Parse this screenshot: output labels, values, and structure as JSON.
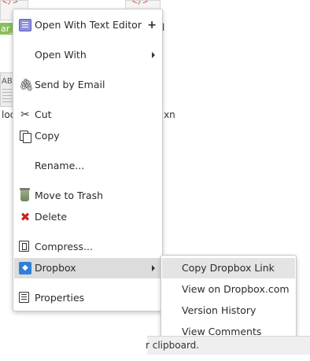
{
  "background": {
    "file_tag": "ar_",
    "doc_label": "AB",
    "file_label_left": "loc",
    "file_label_right": "s.xn",
    "top_right_fragment": "l"
  },
  "context_menu": {
    "items": [
      {
        "label": "Open With Text Editor",
        "icon": "text-editor-icon",
        "suffix": "+"
      },
      {
        "label": "Open With",
        "icon": "",
        "submenu": true
      },
      {
        "label": "Send by Email",
        "icon": "paperclip-icon"
      },
      {
        "label": "Cut",
        "icon": "scissors-icon"
      },
      {
        "label": "Copy",
        "icon": "copy-icon"
      },
      {
        "label": "Rename...",
        "icon": ""
      },
      {
        "label": "Move to Trash",
        "icon": "trash-icon"
      },
      {
        "label": "Delete",
        "icon": "delete-icon"
      },
      {
        "label": "Compress...",
        "icon": "compress-icon"
      },
      {
        "label": "Dropbox",
        "icon": "dropbox-icon",
        "submenu": true,
        "active": true
      },
      {
        "label": "Properties",
        "icon": "properties-icon"
      }
    ]
  },
  "dropbox_submenu": {
    "items": [
      {
        "label": "Copy Dropbox Link",
        "active": true
      },
      {
        "label": "View on Dropbox.com"
      },
      {
        "label": "Version History"
      },
      {
        "label": "View Comments"
      }
    ]
  },
  "status_bar": {
    "text": "r clipboard."
  },
  "colors": {
    "menu_bg": "#ffffff",
    "active_item": "#dcdcdc",
    "dropbox_blue": "#2f7ed8",
    "delete_red": "#cc2222",
    "status_bg": "#efefef"
  }
}
